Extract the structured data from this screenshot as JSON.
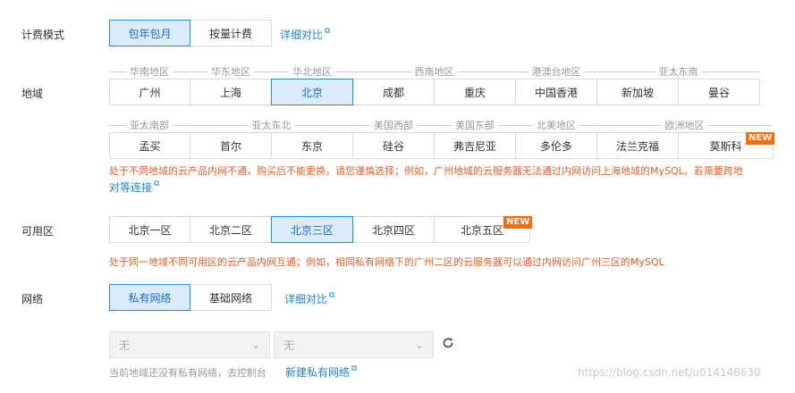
{
  "billing": {
    "label": "计费模式",
    "options": [
      "包年包月",
      "按量计费"
    ],
    "compare_link": "详细对比"
  },
  "region": {
    "label": "地域",
    "groups_row1": [
      "华南地区",
      "华东地区",
      "华北地区",
      "西南地区",
      "港澳台地区",
      "亚太东南"
    ],
    "groups_row2": [
      "亚太南部",
      "亚太东北",
      "美国西部",
      "美国东部",
      "北美地区",
      "欧洲地区"
    ],
    "row1": [
      "广州",
      "上海",
      "北京",
      "成都",
      "重庆",
      "中国香港",
      "新加坡",
      "曼谷"
    ],
    "row2": [
      "孟买",
      "首尔",
      "东京",
      "硅谷",
      "弗吉尼亚",
      "多伦多",
      "法兰克福",
      "莫斯科"
    ],
    "new_badge": "NEW",
    "warning_line1": "处于不同地域的云产品内网不通，购买后不能更换，请您谨慎选择；例如，广州地域的云服务器无法通过内网访问上海地域的MySQL。若需要跨地",
    "warning_link": "对等连接"
  },
  "zone": {
    "label": "可用区",
    "options": [
      "北京一区",
      "北京二区",
      "北京三区",
      "北京四区",
      "北京五区"
    ],
    "new_badge": "NEW",
    "warning": "处于同一地域不同可用区的云产品内网互通；例如，相同私有网络下的广州二区的云服务器可以通过内网访问广州三区的MySQL"
  },
  "network": {
    "label": "网络",
    "options": [
      "私有网络",
      "基础网络"
    ],
    "compare_link": "详细对比",
    "select1": "无",
    "select2": "无",
    "hint": "当前地域还没有私有网络，去控制台",
    "create_link": "新建私有网络"
  },
  "watermark": "https://blog.csdn.net/u014148630",
  "colors": {
    "accent": "#1f86d6",
    "active_bg": "#dcebfa",
    "warning": "#e5622b",
    "new_badge": "#ff6a00"
  }
}
